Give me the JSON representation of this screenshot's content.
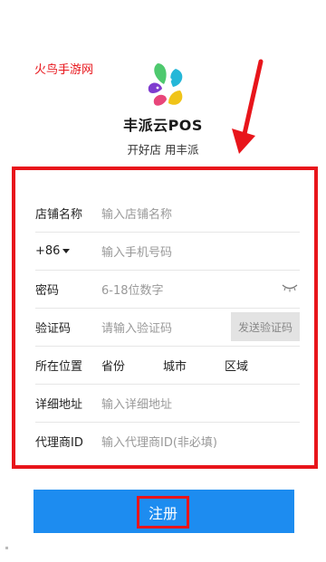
{
  "watermark": "火鸟手游网",
  "brand": {
    "name": "丰派云POS",
    "slogan": "开好店 用丰派"
  },
  "form": {
    "shop_name": {
      "label": "店铺名称",
      "placeholder": "输入店铺名称"
    },
    "phone": {
      "country_code": "+86",
      "placeholder": "输入手机号码"
    },
    "password": {
      "label": "密码",
      "placeholder": "6-18位数字",
      "icon": "eye-closed-icon"
    },
    "verify_code": {
      "label": "验证码",
      "placeholder": "请输入验证码",
      "button": "发送验证码"
    },
    "location": {
      "label": "所在位置",
      "province": "省份",
      "city": "城市",
      "district": "区域"
    },
    "address": {
      "label": "详细地址",
      "placeholder": "输入详细地址"
    },
    "agent_id": {
      "label": "代理商ID",
      "placeholder": "输入代理商ID(非必填)"
    }
  },
  "register": {
    "label": "注册"
  },
  "colors": {
    "accent": "#1d8cf0",
    "annotation": "#e8151b"
  }
}
